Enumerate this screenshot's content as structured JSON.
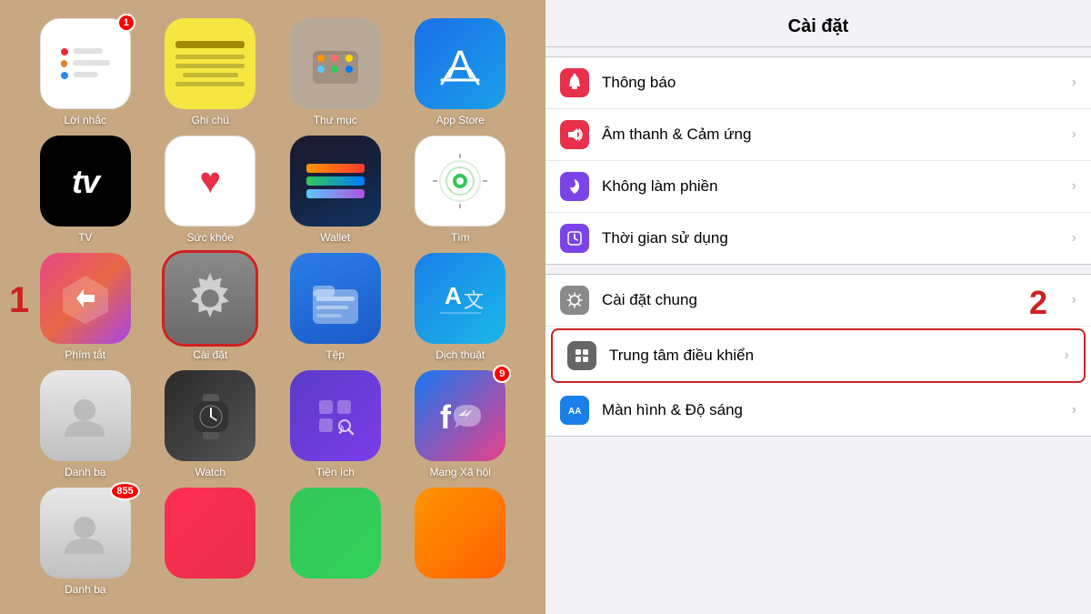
{
  "left": {
    "apps_row1": [
      {
        "id": "reminders",
        "label": "Lời nhắc",
        "badge": "1",
        "icon_type": "reminders"
      },
      {
        "id": "notes",
        "label": "Ghi chú",
        "badge": null,
        "icon_type": "notes"
      },
      {
        "id": "contacts_folder",
        "label": "Thư mục",
        "badge": null,
        "icon_type": "contacts_folder"
      },
      {
        "id": "appstore",
        "label": "App Store",
        "badge": null,
        "icon_type": "appstore"
      }
    ],
    "apps_row2": [
      {
        "id": "tv",
        "label": "TV",
        "badge": null,
        "icon_type": "tv"
      },
      {
        "id": "health",
        "label": "Sức khỏe",
        "badge": null,
        "icon_type": "health"
      },
      {
        "id": "wallet",
        "label": "Wallet",
        "badge": null,
        "icon_type": "wallet"
      },
      {
        "id": "find",
        "label": "Tìm",
        "badge": null,
        "icon_type": "find"
      }
    ],
    "apps_row3": [
      {
        "id": "shortcuts",
        "label": "Phím tắt",
        "badge": null,
        "icon_type": "shortcuts"
      },
      {
        "id": "settings",
        "label": "Cài đặt",
        "badge": null,
        "icon_type": "settings",
        "highlighted": true
      },
      {
        "id": "files",
        "label": "Tệp",
        "badge": null,
        "icon_type": "files"
      },
      {
        "id": "translate",
        "label": "Dịch thuật",
        "badge": null,
        "icon_type": "translate"
      }
    ],
    "apps_row4": [
      {
        "id": "contacts",
        "label": "Danh bạ",
        "badge": null,
        "icon_type": "contacts"
      },
      {
        "id": "watch",
        "label": "Watch",
        "badge": null,
        "icon_type": "watch"
      },
      {
        "id": "utilities",
        "label": "Tiện ích",
        "badge": null,
        "icon_type": "utilities"
      },
      {
        "id": "social",
        "label": "Mạng Xã hội",
        "badge": "9",
        "icon_type": "social"
      }
    ],
    "apps_row5_partial": [
      {
        "id": "phone",
        "label": "Danh bạ",
        "badge": "855",
        "icon_type": "contacts2"
      }
    ]
  },
  "right": {
    "title": "Cài đặt",
    "sections": [
      {
        "rows": [
          {
            "id": "notifications",
            "label": "Thông báo",
            "icon_color": "#e8304a",
            "icon_symbol": "🔔"
          },
          {
            "id": "sounds",
            "label": "Âm thanh & Cảm ứng",
            "icon_color": "#e8304a",
            "icon_symbol": "🔊"
          },
          {
            "id": "dnd",
            "label": "Không làm phiền",
            "icon_color": "#7b44e8",
            "icon_symbol": "🌙"
          },
          {
            "id": "screentime",
            "label": "Thời gian sử dụng",
            "icon_color": "#7b44e8",
            "icon_symbol": "⏱"
          }
        ]
      },
      {
        "rows": [
          {
            "id": "general",
            "label": "Cài đặt chung",
            "icon_color": "#8a8a8a",
            "icon_symbol": "⚙️"
          },
          {
            "id": "control",
            "label": "Trung tâm điều khiển",
            "icon_color": "#666666",
            "icon_symbol": "⊞",
            "highlighted": true
          },
          {
            "id": "display",
            "label": "Màn hình & Độ sáng",
            "icon_color": "#1a7fe8",
            "icon_symbol": "AA"
          }
        ]
      }
    ],
    "step2_label": "2",
    "chevron": "›"
  }
}
